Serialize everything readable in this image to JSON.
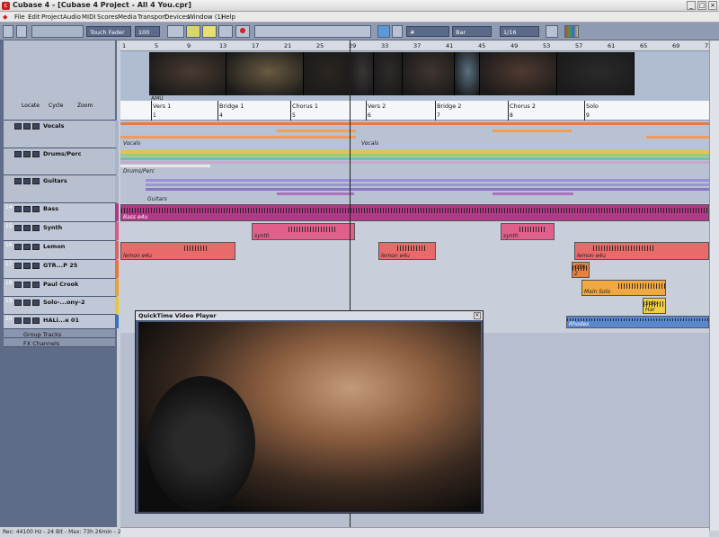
{
  "window": {
    "title": "Cubase 4 - [Cubase 4 Project - All 4 You.cpr]",
    "min": "_",
    "max": "□",
    "close": "×"
  },
  "menu": [
    "File",
    "Edit",
    "Project",
    "Audio",
    "MIDI",
    "Scores",
    "Media",
    "Transport",
    "Devices",
    "Window (1)",
    "Help"
  ],
  "toolbar": {
    "automation_mode": "Touch Fader",
    "autofade": "100 ms",
    "grid_type": "Bar",
    "quantize": "1/16"
  },
  "ruler": {
    "bars": [
      "1",
      "5",
      "9",
      "13",
      "17",
      "21",
      "25",
      "29",
      "33",
      "37",
      "41",
      "45",
      "49",
      "53",
      "57",
      "61",
      "65",
      "69",
      "73"
    ]
  },
  "video_track": {
    "label": "AMU",
    "thumb_colors": [
      "#4a3a30",
      "#6a5a40",
      "#2a2520",
      "#3a3535",
      "#2f2a28",
      "#403530",
      "#5a7080",
      "#503a30",
      "#2a2a2a"
    ]
  },
  "inspector": {
    "locate": "Locate",
    "cycle": "Cycle",
    "zoom": "Zoom"
  },
  "markers": [
    {
      "label": "Vers 1",
      "num": "1"
    },
    {
      "label": "Bridge 1",
      "num": "4"
    },
    {
      "label": "Chorus 1",
      "num": "5"
    },
    {
      "label": "Vers 2",
      "num": "6"
    },
    {
      "label": "Bridge 2",
      "num": "7"
    },
    {
      "label": "Chorus 2",
      "num": "8"
    },
    {
      "label": "Solo",
      "num": "9"
    }
  ],
  "tracks": [
    {
      "num": "",
      "name": "Vocals",
      "color": "#a8b4c8"
    },
    {
      "num": "",
      "name": "Drums/Perc",
      "color": "#a8b4c8"
    },
    {
      "num": "",
      "name": "Guitars",
      "color": "#a8b4c8"
    },
    {
      "num": "14",
      "name": "Bass",
      "color": "#b03a88"
    },
    {
      "num": "15",
      "name": "Synth",
      "color": "#d8588a"
    },
    {
      "num": "16",
      "name": "Lemon",
      "color": "#e06060"
    },
    {
      "num": "17",
      "name": "GTR...P 25",
      "color": "#e07838"
    },
    {
      "num": "18",
      "name": "Paul Crook",
      "color": "#e8a030"
    },
    {
      "num": "19",
      "name": "Solo-...ony-2",
      "color": "#e8c830"
    },
    {
      "num": "20",
      "name": "HALi...e 01",
      "color": "#3870c0"
    },
    {
      "num": "",
      "name": "Group Tracks",
      "color": "#5e6c88"
    },
    {
      "num": "",
      "name": "FX Channels",
      "color": "#5e6c88"
    }
  ],
  "parts": {
    "vocals": "Vocals",
    "drums": "Drums/Perc",
    "guitars": "Guitars",
    "bass": "Bass e4u",
    "synth": "synth",
    "lemon": "lemon e4u",
    "gtr": "GTR-2",
    "mainsolo": "Main Solo",
    "soloharm": "Solo-Har",
    "rhodes": "Rhodes"
  },
  "status": "Rec: 44100 Hz - 24 Bit - Max: 73h 26min - 25 fps -",
  "quicktime": {
    "title": "QuickTime Video Player",
    "close": "×"
  }
}
